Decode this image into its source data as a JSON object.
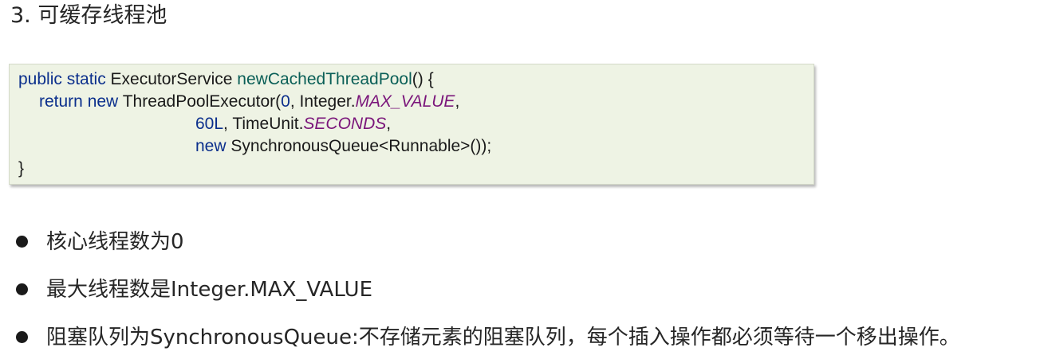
{
  "title": "3. 可缓存线程池",
  "code": {
    "line1": {
      "kw": "public static",
      "type": " ExecutorService ",
      "method": "newCachedThreadPool",
      "rest": "() {"
    },
    "line2": {
      "kw1": "return",
      "sp": " ",
      "kw2": "new",
      "cls": " ThreadPoolExecutor(",
      "num": "0",
      "mid": ", Integer.",
      "field": "MAX_VALUE",
      "end": ","
    },
    "line3": {
      "num": "60L",
      "mid": ", TimeUnit.",
      "field": "SECONDS",
      "end": ","
    },
    "line4": {
      "kw": "new",
      "rest": " SynchronousQueue<Runnable>());"
    },
    "line5": {
      "rest": "}"
    }
  },
  "bullets": [
    "核心线程数为0",
    "最大线程数是Integer.MAX_VALUE",
    "阻塞队列为SynchronousQueue:不存储元素的阻塞队列，每个插入操作都必须等待一个移出操作。"
  ]
}
